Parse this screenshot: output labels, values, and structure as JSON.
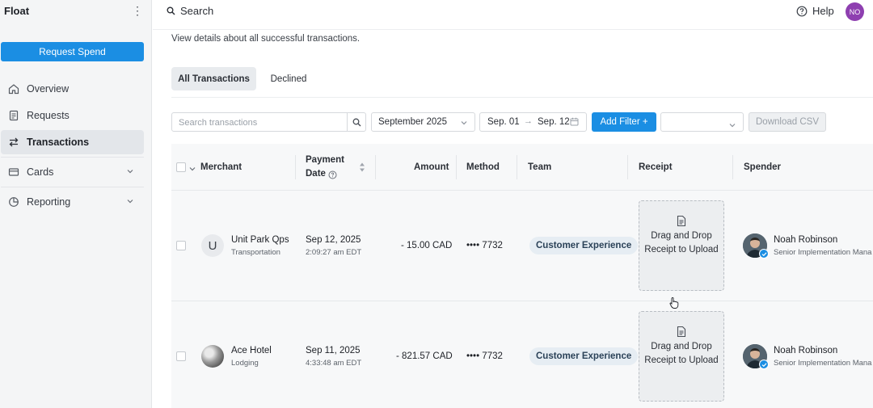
{
  "app": {
    "name": "Float"
  },
  "sidebar": {
    "primary_action": "Request Spend",
    "items": [
      {
        "label": "Overview",
        "icon": "home-icon"
      },
      {
        "label": "Requests",
        "icon": "document-icon"
      },
      {
        "label": "Transactions",
        "icon": "transfer-icon",
        "active": true
      },
      {
        "label": "Cards",
        "icon": "card-icon",
        "expandable": true
      },
      {
        "label": "Reporting",
        "icon": "pie-chart-icon",
        "expandable": true
      }
    ]
  },
  "topbar": {
    "search_label": "Search",
    "help_label": "Help",
    "user_initials": "NO"
  },
  "page": {
    "subtitle": "View details about all successful transactions."
  },
  "tabs": [
    {
      "label": "All Transactions",
      "active": true
    },
    {
      "label": "Declined",
      "active": false
    }
  ],
  "filters": {
    "search_placeholder": "Search transactions",
    "month": "September 2025",
    "date_from": "Sep. 01",
    "date_to": "Sep. 12",
    "add_filter_label": "Add Filter +",
    "extra_select_value": "",
    "download_label": "Download CSV"
  },
  "table": {
    "columns": {
      "merchant": "Merchant",
      "payment_date_line1": "Payment",
      "payment_date_line2": "Date",
      "amount": "Amount",
      "method": "Method",
      "team": "Team",
      "receipt": "Receipt",
      "spender": "Spender"
    },
    "rows": [
      {
        "merchant_initial": "U",
        "merchant_name": "Unit Park Qps",
        "merchant_category": "Transportation",
        "date": "Sep 12, 2025",
        "time": "2:09:27 am EDT",
        "amount": "- 15.00 CAD",
        "method": "•••• 7732",
        "team": "Customer Experience",
        "receipt_text": "Drag and Drop Receipt to Upload",
        "spender_name": "Noah Robinson",
        "spender_title": "Senior Implementation Mana"
      },
      {
        "merchant_initial": "",
        "merchant_name": "Ace Hotel",
        "merchant_category": "Lodging",
        "date": "Sep 11, 2025",
        "time": "4:33:48 am EDT",
        "amount": "- 821.57 CAD",
        "method": "•••• 7732",
        "team": "Customer Experience",
        "receipt_text": "Drag and Drop Receipt to Upload",
        "spender_name": "Noah Robinson",
        "spender_title": "Senior Implementation Mana"
      }
    ]
  },
  "colors": {
    "primary": "#1b8ee3",
    "avatar": "#8e3fb0",
    "sidebar_bg": "#f4f5f6"
  }
}
